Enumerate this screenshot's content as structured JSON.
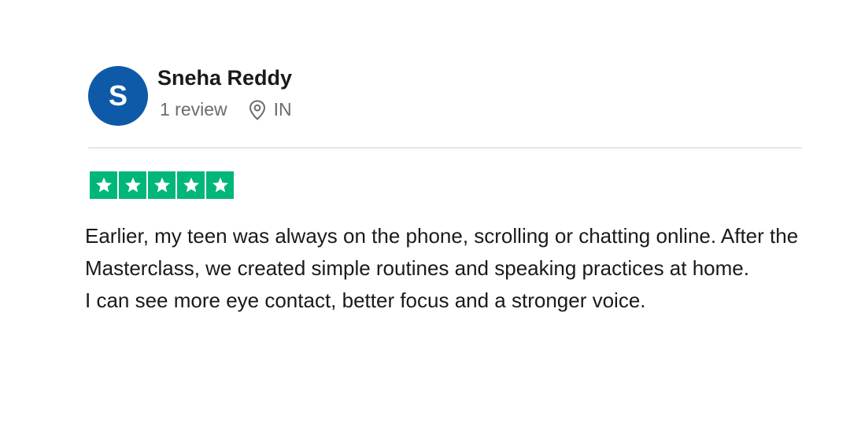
{
  "reviewer": {
    "initial": "S",
    "name": "Sneha Reddy",
    "review_count": "1 review",
    "country": "IN",
    "avatar_color": "#0f5aa8"
  },
  "rating": {
    "stars": 5,
    "max": 5,
    "star_color": "#00b67a"
  },
  "review": {
    "paragraph1": "Earlier, my teen was always on the phone, scrolling or chatting online. After the Masterclass, we created simple routines and speaking practices at home.",
    "paragraph2": "I can see more eye contact, better focus and a stronger voice."
  }
}
